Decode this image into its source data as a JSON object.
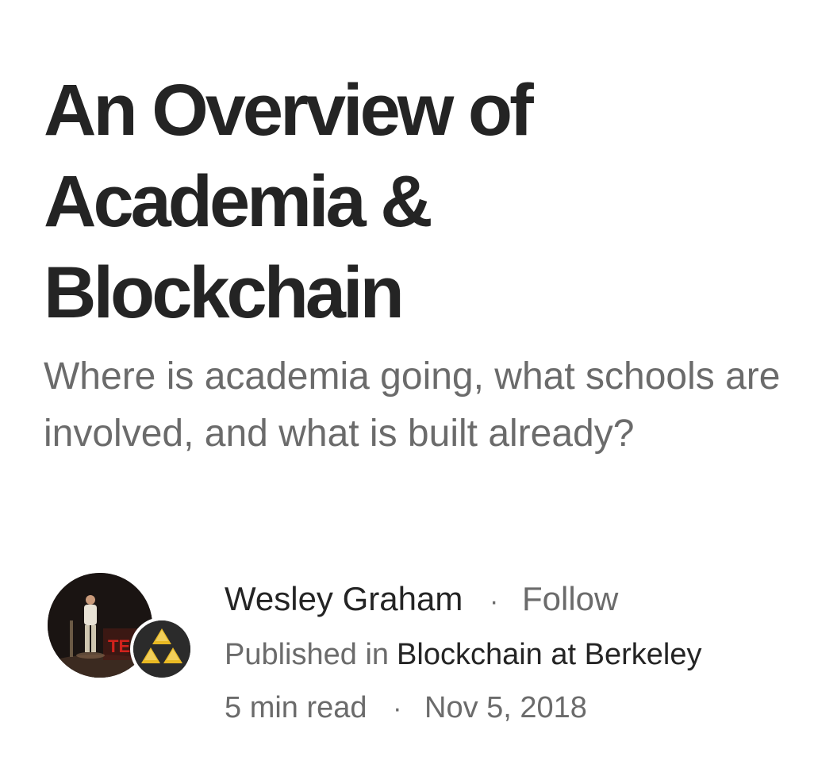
{
  "article": {
    "title_lines": [
      "An Overview of",
      "Academia &",
      "Blockchain"
    ],
    "subtitle": "Where is academia going, what schools are involved, and what is built already?"
  },
  "byline": {
    "author": "Wesley Graham",
    "separator": "·",
    "follow_label": "Follow",
    "published_in_label": "Published in",
    "publication": "Blockchain at Berkeley",
    "read_time": "5 min read",
    "date": "Nov 5, 2018"
  },
  "colors": {
    "text_primary": "#242424",
    "text_secondary": "#6b6b6b",
    "background": "#ffffff",
    "publication_logo": "#e8b923"
  },
  "icons": {
    "author_avatar": "author-photo-avatar",
    "publication_avatar": "blockchain-at-berkeley-logo-icon"
  }
}
